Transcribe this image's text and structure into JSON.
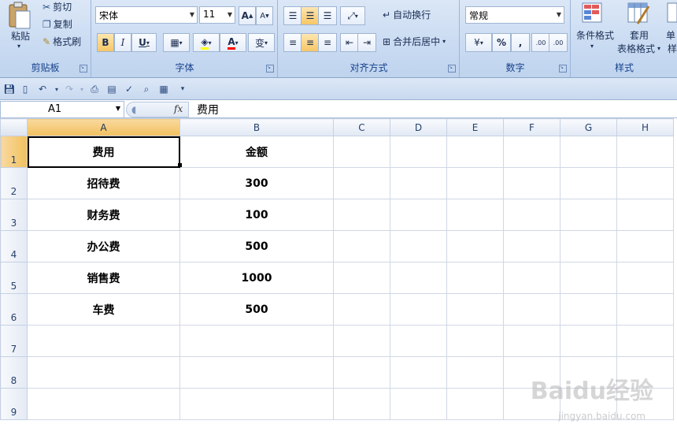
{
  "ribbon": {
    "clipboard": {
      "paste_label": "粘贴",
      "cut_label": "剪切",
      "copy_label": "复制",
      "format_painter_label": "格式刷",
      "group_label": "剪贴板"
    },
    "font": {
      "font_name": "宋体",
      "font_size": "11",
      "bold": "B",
      "italic": "I",
      "underline": "U",
      "grow": "A",
      "shrink": "A",
      "font_color_glyph": "A",
      "wen_glyph": "变",
      "group_label": "字体"
    },
    "alignment": {
      "wrap_text_label": "自动换行",
      "merge_center_label": "合并后居中",
      "group_label": "对齐方式"
    },
    "number": {
      "format": "常规",
      "percent": "%",
      "comma": ",",
      "inc_decimal": ".00",
      "dec_decimal": ".00",
      "group_label": "数字"
    },
    "styles": {
      "conditional_label": "条件格式",
      "table_label_1": "套用",
      "table_label_2": "表格格式",
      "cell_label_1": "单",
      "cell_label_2": "样",
      "group_label": "样式"
    }
  },
  "qat": {
    "icons": [
      "save-icon",
      "new-icon",
      "undo-icon",
      "redo-icon",
      "print-icon",
      "calc-icon",
      "spell-icon",
      "preview-icon",
      "borders-icon",
      "customize-icon"
    ]
  },
  "formula_bar": {
    "name_box": "A1",
    "fx": "fx",
    "value": "费用"
  },
  "sheet": {
    "columns": [
      "A",
      "B",
      "C",
      "D",
      "E",
      "F",
      "G",
      "H"
    ],
    "rows": [
      "1",
      "2",
      "3",
      "4",
      "5",
      "6",
      "7",
      "8",
      "9"
    ],
    "data": [
      [
        "费用",
        "金额"
      ],
      [
        "招待费",
        "300"
      ],
      [
        "财务费",
        "100"
      ],
      [
        "办公费",
        "500"
      ],
      [
        "销售费",
        "1000"
      ],
      [
        "车费",
        "500"
      ]
    ],
    "active_cell": "A1"
  },
  "watermark": {
    "logo": "Baidu经验",
    "url": "jingyan.baidu.com"
  },
  "colors": {
    "ribbon_bg": "#c9dbf2",
    "selected_header": "#f1c15f",
    "grid_line": "#d0d7e5"
  }
}
